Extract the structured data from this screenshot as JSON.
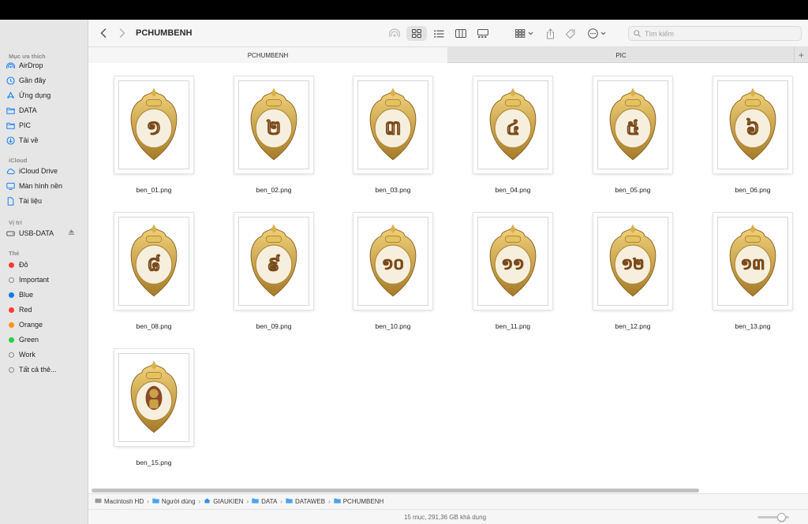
{
  "window": {
    "title": "PCHUMBENH"
  },
  "sidebar": {
    "sections": [
      {
        "label": "Mục ưa thích",
        "items": [
          {
            "label": "AirDrop",
            "icon": "airdrop-icon"
          },
          {
            "label": "Gần đây",
            "icon": "clock-icon"
          },
          {
            "label": "Ứng dụng",
            "icon": "apps-icon"
          },
          {
            "label": "DATA",
            "icon": "folder-icon"
          },
          {
            "label": "PIC",
            "icon": "folder-icon"
          },
          {
            "label": "Tải về",
            "icon": "download-icon"
          }
        ]
      },
      {
        "label": "iCloud",
        "items": [
          {
            "label": "iCloud Drive",
            "icon": "cloud-icon"
          },
          {
            "label": "Màn hình nền",
            "icon": "desktop-icon"
          },
          {
            "label": "Tài liệu",
            "icon": "document-icon"
          }
        ]
      },
      {
        "label": "Vị trí",
        "items": [
          {
            "label": "USB-DATA",
            "icon": "drive-icon"
          }
        ]
      },
      {
        "label": "Thẻ",
        "items": [
          {
            "label": "Đỏ",
            "color": "#ff3b30"
          },
          {
            "label": "Important",
            "color": "hollow"
          },
          {
            "label": "Blue",
            "color": "#007aff"
          },
          {
            "label": "Red",
            "color": "#ff3b30"
          },
          {
            "label": "Orange",
            "color": "#ff9500"
          },
          {
            "label": "Green",
            "color": "#28cd41"
          },
          {
            "label": "Work",
            "color": "hollow"
          },
          {
            "label": "Tất cả thẻ...",
            "color": "hollow"
          }
        ]
      }
    ]
  },
  "search": {
    "placeholder": "Tìm kiếm"
  },
  "tabs": [
    {
      "label": "PCHUMBENH",
      "active": true
    },
    {
      "label": "PIC",
      "active": false
    }
  ],
  "tab_add": "+",
  "files": [
    {
      "name": "ben_01.png",
      "glyph": "១"
    },
    {
      "name": "ben_02.png",
      "glyph": "២"
    },
    {
      "name": "ben_03.png",
      "glyph": "៣"
    },
    {
      "name": "ben_04.png",
      "glyph": "៤"
    },
    {
      "name": "ben_05.png",
      "glyph": "៥"
    },
    {
      "name": "ben_06.png",
      "glyph": "៦"
    },
    {
      "name": "ben_08.png",
      "glyph": "៨"
    },
    {
      "name": "ben_09.png",
      "glyph": "៩"
    },
    {
      "name": "ben_10.png",
      "glyph": "១០"
    },
    {
      "name": "ben_11.png",
      "glyph": "១១"
    },
    {
      "name": "ben_12.png",
      "glyph": "១២"
    },
    {
      "name": "ben_13.png",
      "glyph": "១៣"
    },
    {
      "name": "ben_15.png",
      "glyph": ""
    }
  ],
  "pathbar": [
    {
      "label": "Macintosh HD",
      "icon": "disk-icon"
    },
    {
      "label": "Người dùng",
      "icon": "folder-icon"
    },
    {
      "label": "GIAUKIEN",
      "icon": "home-icon"
    },
    {
      "label": "DATA",
      "icon": "folder-icon"
    },
    {
      "label": "DATAWEB",
      "icon": "folder-icon"
    },
    {
      "label": "PCHUMBENH",
      "icon": "folder-icon"
    }
  ],
  "status": {
    "text": "15 mục, 291,36 GB khả dụng",
    "zoom_level": 0.75
  },
  "colors": {
    "accent": "#1a82f7",
    "gold": "#c9a245",
    "ivory": "#f3ead4"
  }
}
